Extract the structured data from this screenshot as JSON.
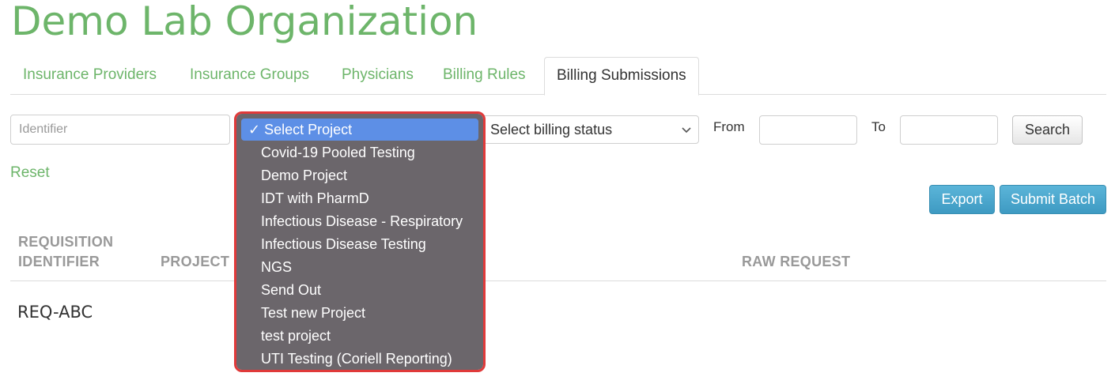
{
  "org": {
    "title": "Demo Lab Organization"
  },
  "tabs": [
    {
      "label": "Insurance Providers"
    },
    {
      "label": "Insurance Groups"
    },
    {
      "label": "Physicians"
    },
    {
      "label": "Billing Rules"
    },
    {
      "label": "Billing Submissions",
      "active": true
    }
  ],
  "filters": {
    "identifier_placeholder": "Identifier",
    "billing_status": "Select billing status",
    "from_label": "From",
    "to_label": "To",
    "search_label": "Search",
    "reset_label": "Reset"
  },
  "actions": {
    "export_label": "Export",
    "submit_batch_label": "Submit Batch"
  },
  "table": {
    "headers": {
      "requisition_line1": "REQUISITION",
      "requisition_line2": "IDENTIFIER",
      "project": "PROJECT",
      "raw_request": "RAW REQUEST"
    },
    "rows": [
      {
        "requisition_identifier": "REQ-ABC"
      }
    ]
  },
  "project_dropdown": {
    "selected_check": "✓",
    "options": [
      "Select Project",
      "Covid-19 Pooled Testing",
      "Demo Project",
      "IDT with PharmD",
      "Infectious Disease - Respiratory",
      "Infectious Disease Testing",
      "NGS",
      "Send Out",
      "Test new Project",
      "test project",
      "UTI Testing (Coriell Reporting)"
    ]
  },
  "colors": {
    "brand_green": "#6db56a",
    "button_blue": "#4aa6cc",
    "dropdown_bg": "#6b666b",
    "dropdown_selected": "#5d8fe6",
    "highlight_red": "#e03a3a"
  }
}
